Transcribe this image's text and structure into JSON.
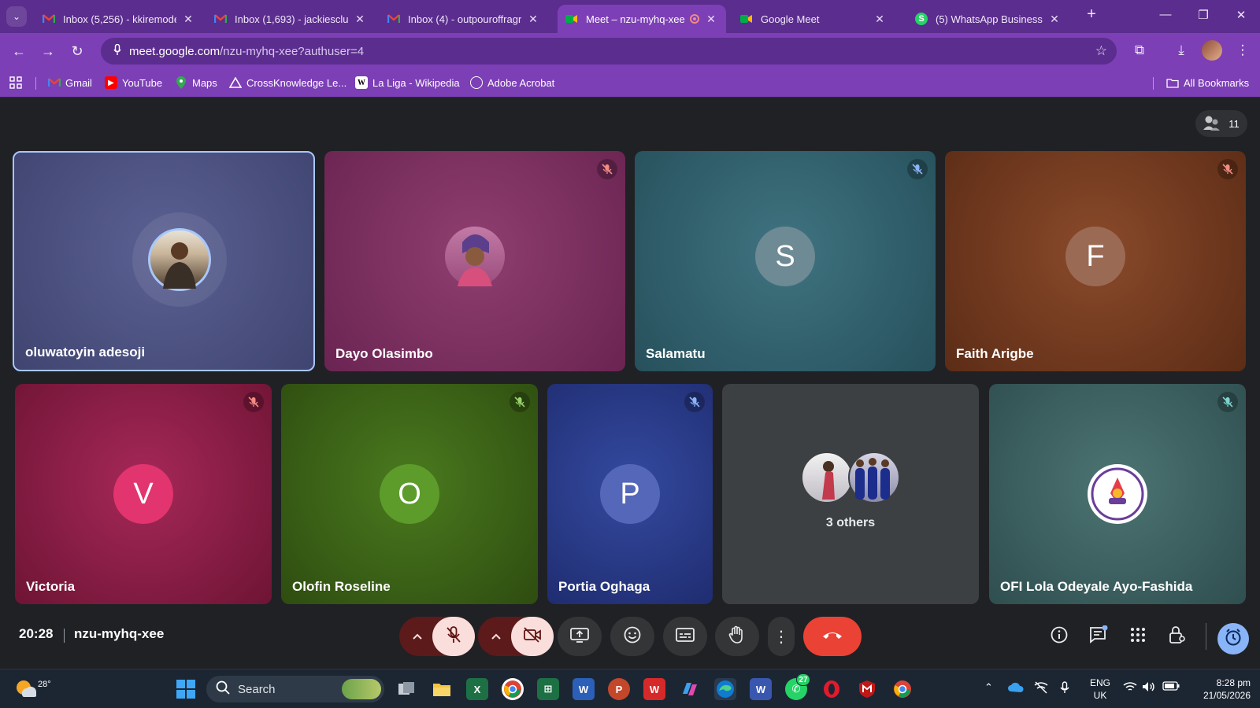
{
  "browser": {
    "tabs": [
      {
        "title": "Inbox (5,256) - kkiremode",
        "icon": "gmail-icon",
        "active": false
      },
      {
        "title": "Inbox (1,693) - jackiesclub",
        "icon": "gmail-icon",
        "active": false
      },
      {
        "title": "Inbox (4) - outpouroffragr",
        "icon": "gmail-icon",
        "active": false
      },
      {
        "title": "Meet – nzu-myhq-xee",
        "icon": "meet-icon",
        "active": true
      },
      {
        "title": "Google Meet",
        "icon": "meet-icon",
        "active": false
      },
      {
        "title": "(5) WhatsApp Business",
        "icon": "whatsapp-icon",
        "active": false
      }
    ],
    "url_host": "meet.google.com",
    "url_path": "/nzu-myhq-xee?authuser=4",
    "bookmarks": [
      {
        "label": "Gmail",
        "icon": "gmail-icon"
      },
      {
        "label": "YouTube",
        "icon": "youtube-icon"
      },
      {
        "label": "Maps",
        "icon": "maps-icon"
      },
      {
        "label": "CrossKnowledge Le...",
        "icon": "crossknowledge-icon"
      },
      {
        "label": "La Liga - Wikipedia",
        "icon": "wikipedia-icon"
      },
      {
        "label": "Adobe Acrobat",
        "icon": "globe-icon"
      }
    ],
    "all_bookmarks": "All Bookmarks"
  },
  "meet": {
    "participant_count": "11",
    "participants": [
      {
        "name": "oluwatoyin adesoji",
        "type": "photo",
        "muted": false,
        "color": "#4a4f80"
      },
      {
        "name": "Dayo Olasimbo",
        "type": "photo",
        "muted": true,
        "color": "#7a2f5e"
      },
      {
        "name": "Salamatu",
        "initial": "S",
        "type": "initial",
        "muted": true,
        "color": "#2e5a66"
      },
      {
        "name": "Faith Arigbe",
        "initial": "F",
        "type": "initial",
        "muted": true,
        "color": "#74381f"
      },
      {
        "name": "Victoria",
        "initial": "V",
        "type": "initial",
        "muted": true,
        "color": "#8a1c48"
      },
      {
        "name": "Olofin Roseline",
        "initial": "O",
        "type": "initial",
        "muted": true,
        "color": "#3d5e18"
      },
      {
        "name": "Portia Oghaga",
        "initial": "P",
        "type": "initial",
        "muted": true,
        "color": "#2a3c8c"
      },
      {
        "name": "OFI Lola Odeyale Ayo-Fashida",
        "type": "logo",
        "muted": true,
        "color": "#3d6060"
      }
    ],
    "others_label": "3 others",
    "meeting_time": "20:28",
    "meeting_code": "nzu-myhq-xee"
  },
  "taskbar": {
    "weather": "28°",
    "search_placeholder": "Search",
    "lang_top": "ENG",
    "lang_bottom": "UK",
    "time": "8:28 pm",
    "date": "21/05/2026",
    "badges": {
      "whatsapp": "27"
    }
  }
}
